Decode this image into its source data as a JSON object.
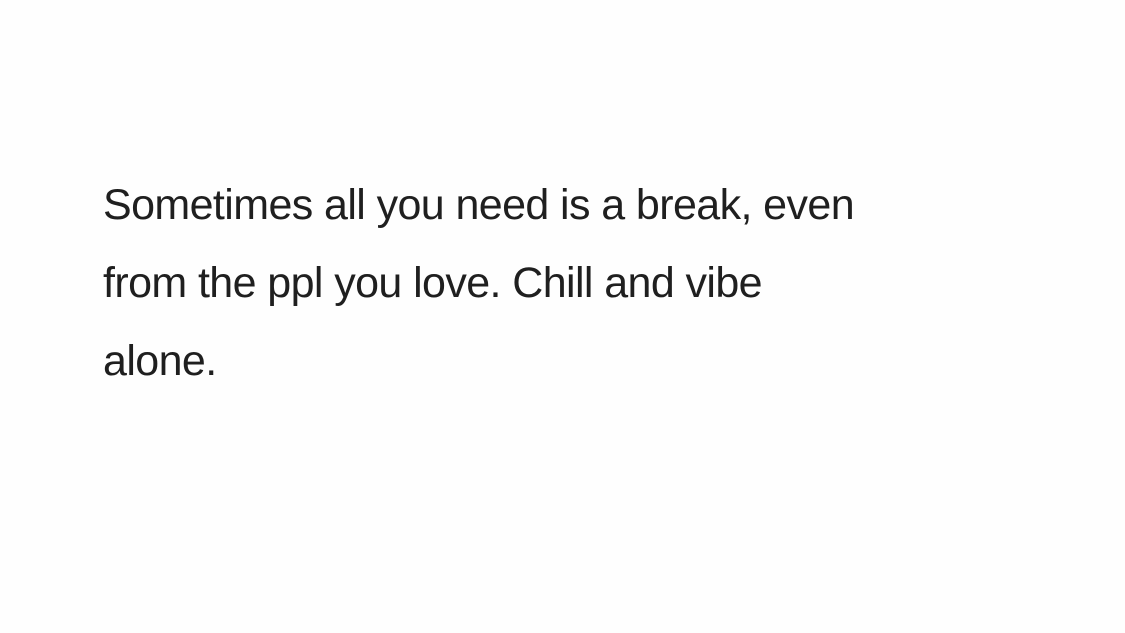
{
  "post": {
    "lines": [
      "Sometimes all you need is a break, even",
      "from the ppl you love. Chill and vibe",
      "alone."
    ]
  },
  "colors": {
    "background": "#fefefe",
    "text": "#1f1f1f"
  }
}
